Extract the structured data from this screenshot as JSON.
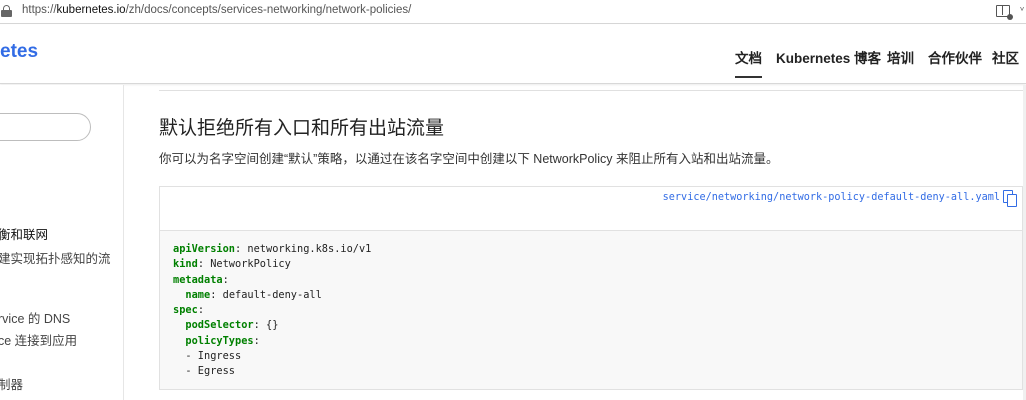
{
  "browser": {
    "url_prefix": "https://",
    "url_host": "kubernetes.io",
    "url_path": "/zh/docs/concepts/services-networking/network-policies/"
  },
  "header": {
    "logo_partial": "etes",
    "nav": [
      "文档",
      "Kubernetes 博客",
      "培训",
      "合作伙伴",
      "社区"
    ]
  },
  "sidebar": {
    "items": [
      "衡和联网",
      "建实现拓扑感知的流",
      "rvice 的 DNS",
      "ce 连接到应用",
      "制器"
    ]
  },
  "content": {
    "title": "默认拒绝所有入口和所有出站流量",
    "description": "你可以为名字空间创建“默认”策略，以通过在该名字空间中创建以下 NetworkPolicy 来阻止所有入站和出站流量。",
    "file_link": "service/networking/network-policy-default-deny-all.yaml",
    "code_lines": [
      {
        "key": "apiVersion",
        "value": ": networking.k8s.io/v1",
        "indent": ""
      },
      {
        "key": "kind",
        "value": ": NetworkPolicy",
        "indent": ""
      },
      {
        "key": "metadata",
        "value": ":",
        "indent": ""
      },
      {
        "key": "name",
        "value": ": default-deny-all",
        "indent": "  "
      },
      {
        "key": "spec",
        "value": ":",
        "indent": ""
      },
      {
        "key": "podSelector",
        "value": ": {}",
        "indent": "  "
      },
      {
        "key": "policyTypes",
        "value": ":",
        "indent": "  "
      },
      {
        "key": "",
        "value": "- Ingress",
        "indent": "  "
      },
      {
        "key": "",
        "value": "- Egress",
        "indent": "  "
      }
    ]
  },
  "icons": {
    "lock": "lock-icon",
    "reader": "reader-view-icon",
    "copy": "copy-icon"
  },
  "colors": {
    "brand": "#326ce5",
    "yaml_key": "#008000",
    "code_bg": "#f8f8f8"
  }
}
